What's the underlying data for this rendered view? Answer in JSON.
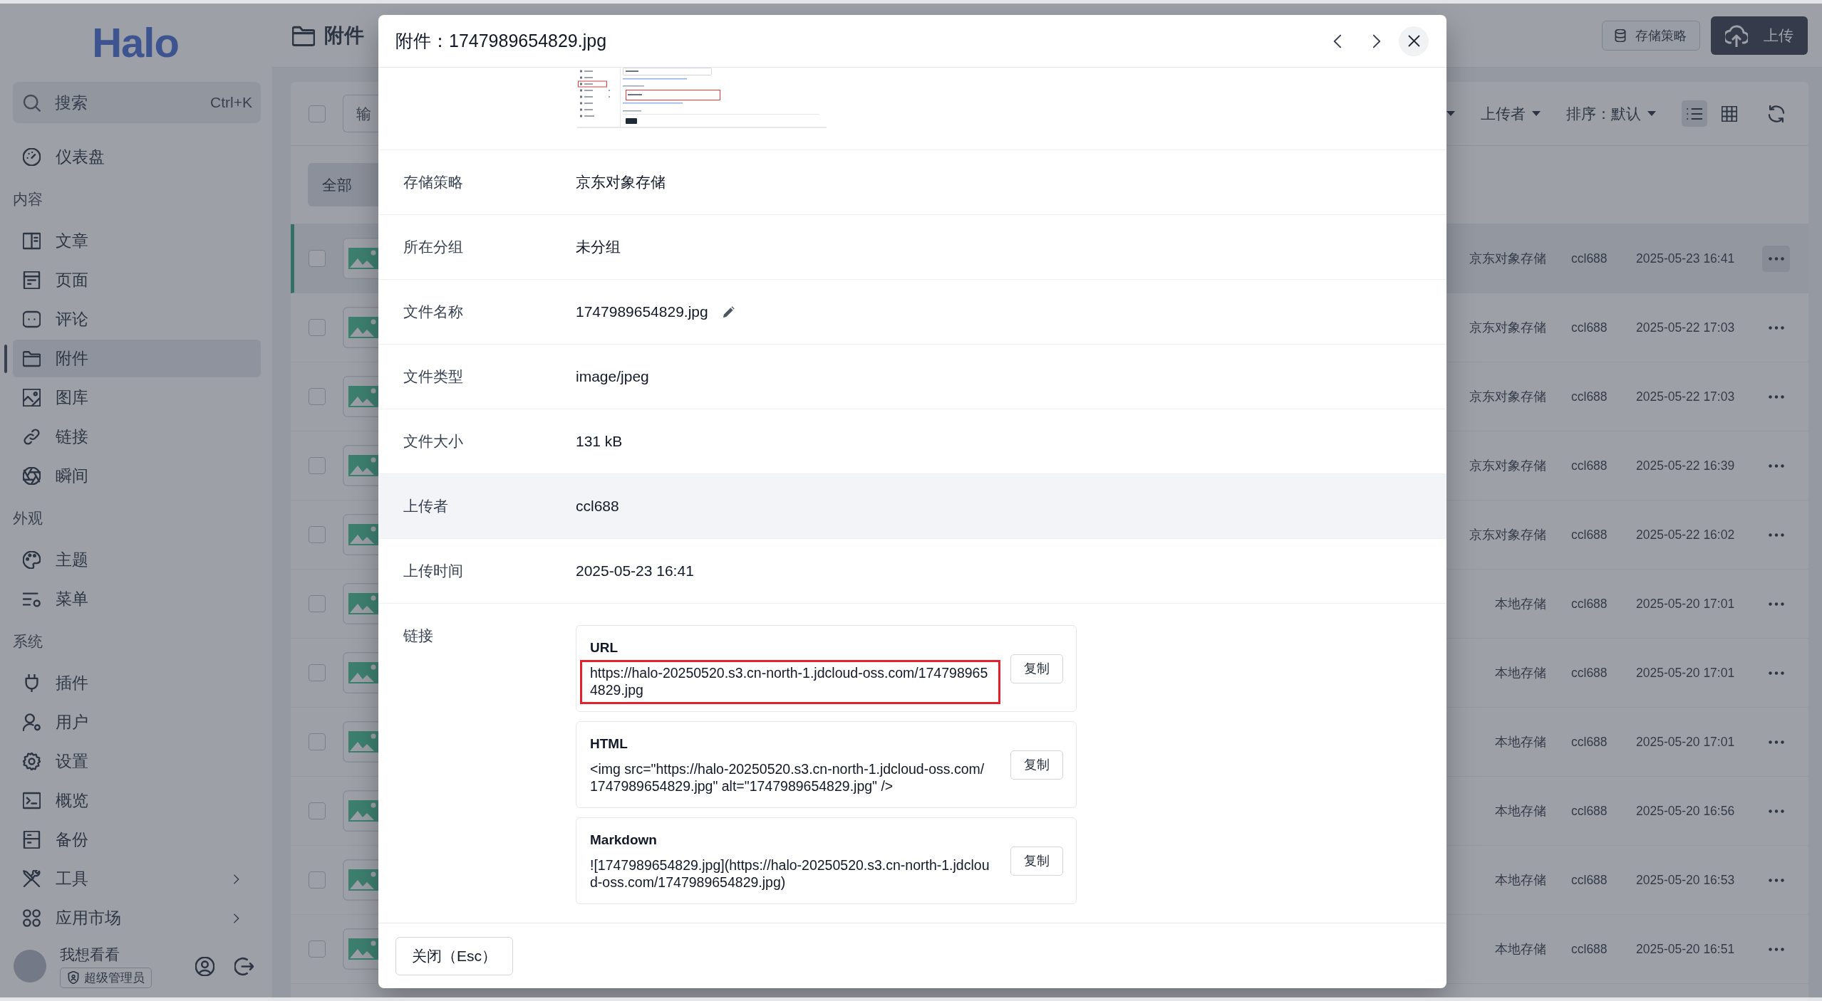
{
  "sidebar": {
    "logo": "Halo",
    "search": {
      "placeholder": "搜索",
      "shortcut": "Ctrl+K"
    },
    "sections": [
      {
        "items": [
          {
            "label": "仪表盘",
            "selected": false,
            "has_submenu": false
          }
        ]
      },
      {
        "title": "内容",
        "items": [
          {
            "label": "文章",
            "selected": false,
            "has_submenu": false
          },
          {
            "label": "页面",
            "selected": false,
            "has_submenu": false
          },
          {
            "label": "评论",
            "selected": false,
            "has_submenu": false
          },
          {
            "label": "附件",
            "selected": true,
            "has_submenu": false
          },
          {
            "label": "图库",
            "selected": false,
            "has_submenu": false
          },
          {
            "label": "链接",
            "selected": false,
            "has_submenu": false
          },
          {
            "label": "瞬间",
            "selected": false,
            "has_submenu": false
          }
        ]
      },
      {
        "title": "外观",
        "items": [
          {
            "label": "主题",
            "selected": false,
            "has_submenu": false
          },
          {
            "label": "菜单",
            "selected": false,
            "has_submenu": false
          }
        ]
      },
      {
        "title": "系统",
        "items": [
          {
            "label": "插件",
            "selected": false,
            "has_submenu": false
          },
          {
            "label": "用户",
            "selected": false,
            "has_submenu": false
          },
          {
            "label": "设置",
            "selected": false,
            "has_submenu": false
          },
          {
            "label": "概览",
            "selected": false,
            "has_submenu": false
          },
          {
            "label": "备份",
            "selected": false,
            "has_submenu": false
          },
          {
            "label": "工具",
            "selected": false,
            "has_submenu": true
          },
          {
            "label": "应用市场",
            "selected": false,
            "has_submenu": true
          }
        ]
      }
    ],
    "user": {
      "name": "我想看看",
      "role": "超级管理员"
    }
  },
  "header": {
    "title": "附件",
    "buttons": [
      {
        "label": "存储策略",
        "kind": "default"
      },
      {
        "label": "上传",
        "kind": "primary"
      }
    ]
  },
  "toolbar": {
    "select_all": {
      "checked": false
    },
    "search": {
      "placeholder": "输"
    },
    "filters": [
      {
        "label": "上传者"
      },
      {
        "label": "排序：默认"
      }
    ],
    "view_modes": [
      {
        "kind": "list",
        "selected": true
      },
      {
        "kind": "grid",
        "selected": false
      }
    ]
  },
  "groups": [
    {
      "label": "全部",
      "selected": true
    }
  ],
  "rows": [
    {
      "checked": false,
      "selected": true,
      "policy": "京东对象存储",
      "uploader": "ccl688",
      "time": "2025-05-23 16:41"
    },
    {
      "checked": false,
      "selected": false,
      "policy": "京东对象存储",
      "uploader": "ccl688",
      "time": "2025-05-22 17:03"
    },
    {
      "checked": false,
      "selected": false,
      "policy": "京东对象存储",
      "uploader": "ccl688",
      "time": "2025-05-22 17:03"
    },
    {
      "checked": false,
      "selected": false,
      "policy": "京东对象存储",
      "uploader": "ccl688",
      "time": "2025-05-22 16:39"
    },
    {
      "checked": false,
      "selected": false,
      "policy": "京东对象存储",
      "uploader": "ccl688",
      "time": "2025-05-22 16:02"
    },
    {
      "checked": false,
      "selected": false,
      "policy": "本地存储",
      "uploader": "ccl688",
      "time": "2025-05-20 17:01"
    },
    {
      "checked": false,
      "selected": false,
      "policy": "本地存储",
      "uploader": "ccl688",
      "time": "2025-05-20 17:01"
    },
    {
      "checked": false,
      "selected": false,
      "policy": "本地存储",
      "uploader": "ccl688",
      "time": "2025-05-20 17:01"
    },
    {
      "checked": false,
      "selected": false,
      "policy": "本地存储",
      "uploader": "ccl688",
      "time": "2025-05-20 16:56"
    },
    {
      "checked": false,
      "selected": false,
      "policy": "本地存储",
      "uploader": "ccl688",
      "time": "2025-05-20 16:53"
    },
    {
      "checked": false,
      "selected": false,
      "policy": "本地存储",
      "uploader": "ccl688",
      "time": "2025-05-20 16:51"
    }
  ],
  "modal": {
    "title": "附件：1747989654829.jpg",
    "details": [
      {
        "label": "存储策略",
        "value": "京东对象存储",
        "editable": false,
        "hovered": false
      },
      {
        "label": "所在分组",
        "value": "未分组",
        "editable": false,
        "hovered": false
      },
      {
        "label": "文件名称",
        "value": "1747989654829.jpg",
        "editable": true,
        "hovered": false
      },
      {
        "label": "文件类型",
        "value": "image/jpeg",
        "editable": false,
        "hovered": false
      },
      {
        "label": "文件大小",
        "value": "131 kB",
        "editable": false,
        "hovered": false
      },
      {
        "label": "上传者",
        "value": "ccl688",
        "editable": false,
        "hovered": true
      },
      {
        "label": "上传时间",
        "value": "2025-05-23 16:41",
        "editable": false,
        "hovered": false
      }
    ],
    "links": {
      "label": "链接",
      "items": [
        {
          "title": "URL",
          "value": "https://halo-20250520.s3.cn-north-1.jdcloud-oss.com/1747989654829.jpg",
          "copy": "复制",
          "annotated": true
        },
        {
          "title": "HTML",
          "value": "<img src=\"https://halo-20250520.s3.cn-north-1.jdcloud-oss.com/1747989654829.jpg\" alt=\"1747989654829.jpg\" />",
          "copy": "复制",
          "annotated": false
        },
        {
          "title": "Markdown",
          "value": "![1747989654829.jpg](https://halo-20250520.s3.cn-north-1.jdcloud-oss.com/1747989654829.jpg)",
          "copy": "复制",
          "annotated": false
        }
      ]
    },
    "close_button": "关闭（Esc）"
  }
}
